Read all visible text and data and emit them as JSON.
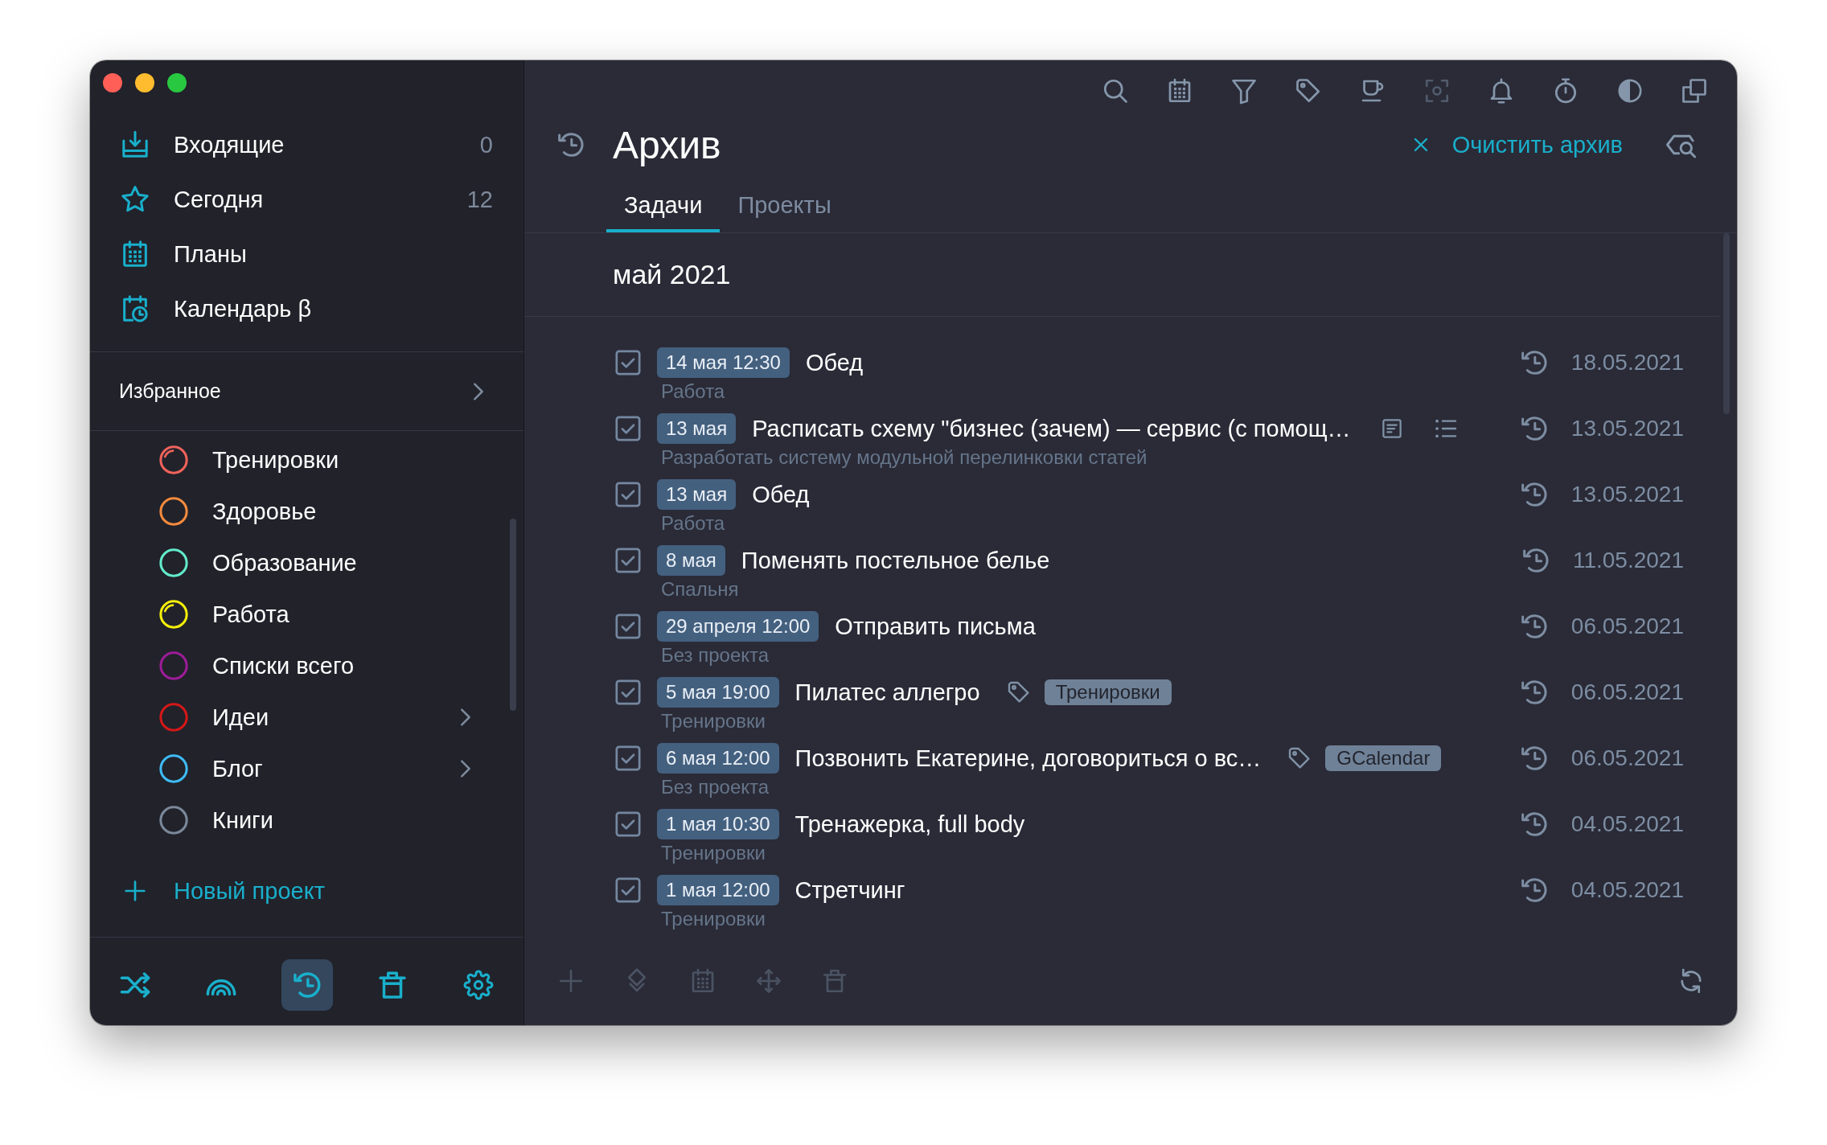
{
  "window": {
    "controls": [
      {
        "kind": "close"
      },
      {
        "kind": "minimize"
      },
      {
        "kind": "zoom"
      }
    ]
  },
  "sidebar": {
    "nav": [
      {
        "label": "Входящие",
        "count": "0",
        "selected": false
      },
      {
        "label": "Сегодня",
        "count": "12",
        "selected": false
      },
      {
        "label": "Планы",
        "selected": false
      },
      {
        "label": "Календарь β",
        "selected": false
      }
    ],
    "favorites": {
      "label": "Избранное",
      "expanded": false
    },
    "projects": [
      {
        "name": "Тренировки",
        "color": "#f0625b",
        "in_progress": true,
        "expandable": false
      },
      {
        "name": "Здоровье",
        "color": "#f58a3d",
        "in_progress": false,
        "expandable": false
      },
      {
        "name": "Образование",
        "color": "#62ebcb",
        "in_progress": false,
        "expandable": false
      },
      {
        "name": "Работа",
        "color": "#f4ee0a",
        "in_progress": true,
        "expandable": false
      },
      {
        "name": "Списки всего",
        "color": "#9c1c98",
        "in_progress": false,
        "expandable": false
      },
      {
        "name": "Идеи",
        "color": "#d41818",
        "in_progress": false,
        "expandable": true
      },
      {
        "name": "Блог",
        "color": "#3ebbf5",
        "in_progress": false,
        "expandable": true
      },
      {
        "name": "Книги",
        "color": "#7b889a",
        "in_progress": false,
        "expandable": false
      }
    ],
    "new_project": "Новый проект",
    "bottom_bar": [
      {
        "selected": false
      },
      {
        "selected": false
      },
      {
        "selected": true
      },
      {
        "selected": false
      },
      {
        "selected": false
      }
    ]
  },
  "toolbar": [
    {
      "disabled": false
    },
    {
      "disabled": false
    },
    {
      "disabled": false
    },
    {
      "disabled": false
    },
    {
      "disabled": false
    },
    {
      "disabled": true
    },
    {
      "disabled": false
    },
    {
      "disabled": false
    },
    {
      "disabled": false
    },
    {
      "disabled": false
    }
  ],
  "header": {
    "title": "Архив",
    "action": "Очистить архив"
  },
  "tabs": [
    {
      "label": "Задачи",
      "selected": true
    },
    {
      "label": "Проекты",
      "selected": false
    }
  ],
  "group": {
    "title": "май 2021"
  },
  "tasks": [
    {
      "done": true,
      "due": "14 мая 12:30",
      "title": "Обед",
      "project": "Работа",
      "archived": "18.05.2021"
    },
    {
      "done": true,
      "due": "13 мая",
      "title": "Расписать схему \"бизнес (зачем) — сервис (с помощ…",
      "project": "Разработать систему модульной перелинковки статей",
      "notes": true,
      "subtasks": true,
      "archived": "13.05.2021"
    },
    {
      "done": true,
      "due": "13 мая",
      "title": "Обед",
      "project": "Работа",
      "archived": "13.05.2021"
    },
    {
      "done": true,
      "due": "8 мая",
      "title": "Поменять постельное белье",
      "project": "Спальня",
      "archived": "11.05.2021"
    },
    {
      "done": true,
      "due": "29 апреля 12:00",
      "title": "Отправить письма",
      "project": "Без проекта",
      "archived": "06.05.2021"
    },
    {
      "done": true,
      "due": "5 мая 19:00",
      "title": "Пилатес аллегро",
      "tags": [
        "Тренировки"
      ],
      "project": "Тренировки",
      "archived": "06.05.2021"
    },
    {
      "done": true,
      "due": "6 мая 12:00",
      "title": "Позвонить Екатерине, договориться о вс…",
      "tags": [
        "GCalendar"
      ],
      "project": "Без проекта",
      "archived": "06.05.2021"
    },
    {
      "done": true,
      "due": "1 мая 10:30",
      "title": "Тренажерка, full body",
      "project": "Тренировки",
      "archived": "04.05.2021"
    },
    {
      "done": true,
      "due": "1 мая 12:00",
      "title": "Стретчинг",
      "project": "Тренировки",
      "archived": "04.05.2021"
    }
  ],
  "bottom_actions": [
    {
      "disabled": true
    },
    {
      "disabled": true
    },
    {
      "disabled": true
    },
    {
      "disabled": true
    },
    {
      "disabled": true
    },
    {
      "disabled": false
    }
  ]
}
